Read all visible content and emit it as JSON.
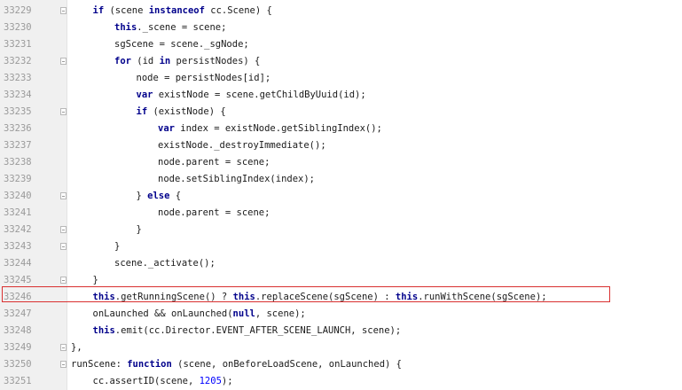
{
  "editor": {
    "highlight_color": "#d93030",
    "keyword_color": "#00008b",
    "number_color": "#0000ff",
    "lines": [
      {
        "num": "33229",
        "indent": 4,
        "fold": true,
        "tokens": [
          {
            "t": "if",
            "k": "kw"
          },
          {
            "t": " (scene "
          },
          {
            "t": "instanceof",
            "k": "kw"
          },
          {
            "t": " cc.Scene) {"
          }
        ]
      },
      {
        "num": "33230",
        "indent": 5,
        "fold": false,
        "tokens": [
          {
            "t": "this",
            "k": "kw"
          },
          {
            "t": "._scene = scene;"
          }
        ]
      },
      {
        "num": "33231",
        "indent": 5,
        "fold": false,
        "tokens": [
          {
            "t": "sgScene = scene._sgNode;"
          }
        ]
      },
      {
        "num": "33232",
        "indent": 5,
        "fold": true,
        "tokens": [
          {
            "t": "for",
            "k": "kw"
          },
          {
            "t": " (id "
          },
          {
            "t": "in",
            "k": "kw"
          },
          {
            "t": " persistNodes) {"
          }
        ]
      },
      {
        "num": "33233",
        "indent": 6,
        "fold": false,
        "tokens": [
          {
            "t": "node = persistNodes[id];"
          }
        ]
      },
      {
        "num": "33234",
        "indent": 6,
        "fold": false,
        "tokens": [
          {
            "t": "var",
            "k": "kw"
          },
          {
            "t": " existNode = scene.getChildByUuid(id);"
          }
        ]
      },
      {
        "num": "33235",
        "indent": 6,
        "fold": true,
        "tokens": [
          {
            "t": "if",
            "k": "kw"
          },
          {
            "t": " (existNode) {"
          }
        ]
      },
      {
        "num": "33236",
        "indent": 7,
        "fold": false,
        "tokens": [
          {
            "t": "var",
            "k": "kw"
          },
          {
            "t": " index = existNode.getSiblingIndex();"
          }
        ]
      },
      {
        "num": "33237",
        "indent": 7,
        "fold": false,
        "tokens": [
          {
            "t": "existNode._destroyImmediate();"
          }
        ]
      },
      {
        "num": "33238",
        "indent": 7,
        "fold": false,
        "tokens": [
          {
            "t": "node.parent = scene;"
          }
        ]
      },
      {
        "num": "33239",
        "indent": 7,
        "fold": false,
        "tokens": [
          {
            "t": "node.setSiblingIndex(index);"
          }
        ]
      },
      {
        "num": "33240",
        "indent": 6,
        "fold": true,
        "tokens": [
          {
            "t": "} "
          },
          {
            "t": "else",
            "k": "kw"
          },
          {
            "t": " {"
          }
        ]
      },
      {
        "num": "33241",
        "indent": 7,
        "fold": false,
        "tokens": [
          {
            "t": "node.parent = scene;"
          }
        ]
      },
      {
        "num": "33242",
        "indent": 6,
        "fold": true,
        "tokens": [
          {
            "t": "}"
          }
        ]
      },
      {
        "num": "33243",
        "indent": 5,
        "fold": true,
        "tokens": [
          {
            "t": "}"
          }
        ]
      },
      {
        "num": "33244",
        "indent": 5,
        "fold": false,
        "tokens": [
          {
            "t": "scene._activate();"
          }
        ]
      },
      {
        "num": "33245",
        "indent": 4,
        "fold": true,
        "tokens": [
          {
            "t": "}"
          }
        ]
      },
      {
        "num": "33246",
        "indent": 4,
        "fold": false,
        "highlight": true,
        "tokens": [
          {
            "t": "this",
            "k": "kw"
          },
          {
            "t": ".getRunningScene() ? "
          },
          {
            "t": "this",
            "k": "kw"
          },
          {
            "t": ".replaceScene(sgScene) : "
          },
          {
            "t": "this",
            "k": "kw"
          },
          {
            "t": ".runWithScene(sgScene);"
          }
        ]
      },
      {
        "num": "33247",
        "indent": 4,
        "fold": false,
        "tokens": [
          {
            "t": "onLaunched && onLaunched("
          },
          {
            "t": "null",
            "k": "kw"
          },
          {
            "t": ", scene);"
          }
        ]
      },
      {
        "num": "33248",
        "indent": 4,
        "fold": false,
        "tokens": [
          {
            "t": "this",
            "k": "kw"
          },
          {
            "t": ".emit(cc.Director.EVENT_AFTER_SCENE_LAUNCH, scene);"
          }
        ]
      },
      {
        "num": "33249",
        "indent": 3,
        "fold": true,
        "tokens": [
          {
            "t": "},"
          }
        ]
      },
      {
        "num": "33250",
        "indent": 3,
        "fold": true,
        "tokens": [
          {
            "t": "runScene: "
          },
          {
            "t": "function",
            "k": "kw"
          },
          {
            "t": " (scene, onBeforeLoadScene, onLaunched) {"
          }
        ]
      },
      {
        "num": "33251",
        "indent": 4,
        "fold": false,
        "tokens": [
          {
            "t": "cc.assertID(scene, "
          },
          {
            "t": "1205",
            "k": "num"
          },
          {
            "t": ");"
          }
        ]
      }
    ]
  }
}
